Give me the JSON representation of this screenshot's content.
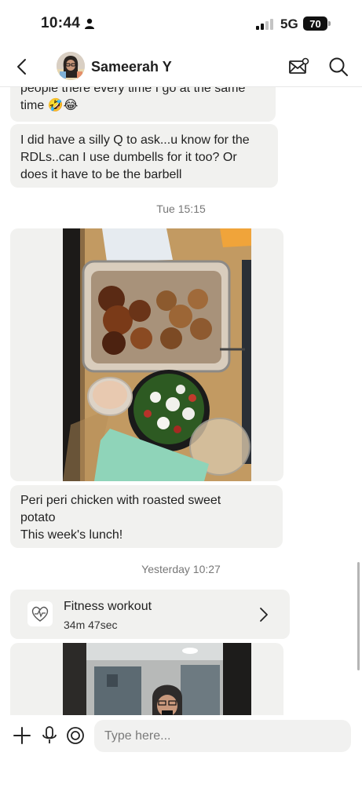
{
  "status_bar": {
    "time": "10:44",
    "network": "5G",
    "battery": "70"
  },
  "header": {
    "contact_name": "Sameerah Y"
  },
  "messages": [
    {
      "text": "people there every time I go at the same\ntime 🤣😂"
    },
    {
      "text": "I did have a silly Q to ask...u know for the\nRDLs..can I use dumbells for it too? Or\ndoes it have to be the barbell"
    },
    {
      "text": "Peri peri chicken with roasted sweet\npotato\nThis week's lunch!"
    }
  ],
  "timestamps": [
    "Tue 15:15",
    "Yesterday 10:27"
  ],
  "workout": {
    "title": "Fitness workout",
    "duration": "34m 47sec"
  },
  "composer": {
    "placeholder": "Type here..."
  },
  "colors": {
    "bubble": "#f1f1ef",
    "accent": "#1f1f1f",
    "timestamp": "#777777"
  }
}
